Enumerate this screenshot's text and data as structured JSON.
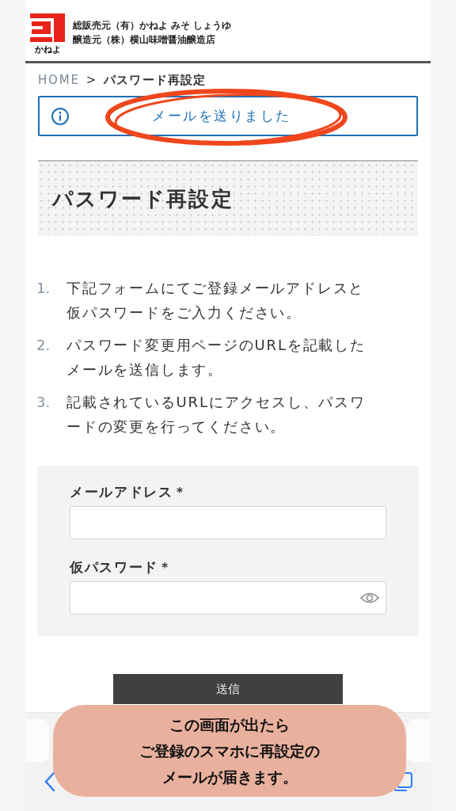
{
  "header": {
    "logo_text": "かねよ",
    "lines": [
      "総販売元（有）かねよ みそ しょうゆ",
      "醸造元（株）横山味噌醤油醸造店"
    ]
  },
  "breadcrumb": [
    {
      "label": "HOME",
      "kind": "link"
    },
    {
      "label": ">",
      "kind": "separator"
    },
    {
      "label": "パスワード再設定",
      "kind": "current"
    }
  ],
  "alert": {
    "message": "メールを送りました"
  },
  "title": "パスワード再設定",
  "steps": [
    {
      "number": "1.",
      "text": "下記フォームにてご登録メールアドレスと仮パスワードをご入力ください。"
    },
    {
      "number": "2.",
      "text": "パスワード変更用ページのURLを記載したメールを送信します。"
    },
    {
      "number": "3.",
      "text": "記載されているURLにアクセスし、パスワードの変更を行ってください。"
    }
  ],
  "form": {
    "fields": [
      {
        "label": "メールアドレス",
        "required_mark": "*",
        "kind": "email"
      },
      {
        "label": "仮パスワード",
        "required_mark": "*",
        "kind": "password"
      }
    ],
    "submit": "送信"
  },
  "callout": {
    "lines": [
      "この画面が出たら",
      "ご登録のスマホに再設定の",
      "メールが届きます。"
    ]
  }
}
